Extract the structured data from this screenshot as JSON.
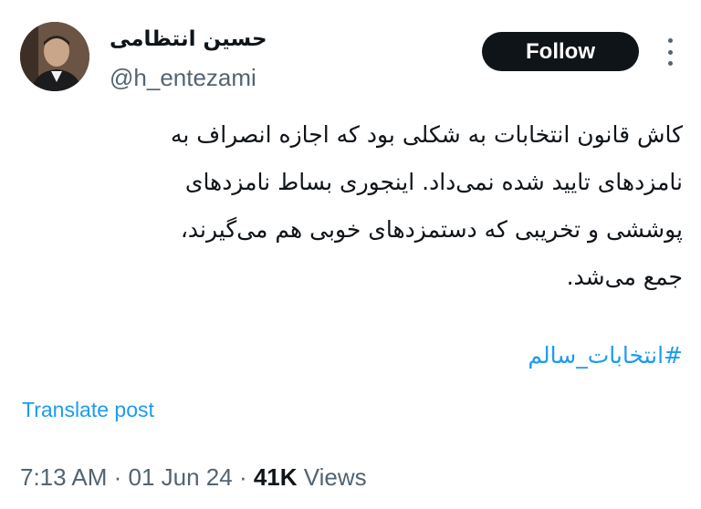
{
  "author": {
    "display_name": "حسین انتظامی",
    "handle": "@h_entezami"
  },
  "follow_label": "Follow",
  "tweet": {
    "lines": [
      "کاش قانون انتخابات به شکلی بود که اجازه انصراف به",
      "نامزدهای تایید شده نمی‌داد. اینجوری بساط نامزدهای",
      "پوششی و تخریبی که دستمزدهای خوبی هم می‌گیرند،",
      "جمع می‌شد."
    ],
    "hashtag": "#انتخابات_سالم"
  },
  "translate_label": "Translate post",
  "meta": {
    "time": "7:13 AM",
    "sep1": " · ",
    "date": "01 Jun 24",
    "sep2": " · ",
    "views_count": "41K",
    "views_label": " Views"
  },
  "icons": {
    "more": "more-vertical-icon",
    "avatar": "profile-photo"
  }
}
